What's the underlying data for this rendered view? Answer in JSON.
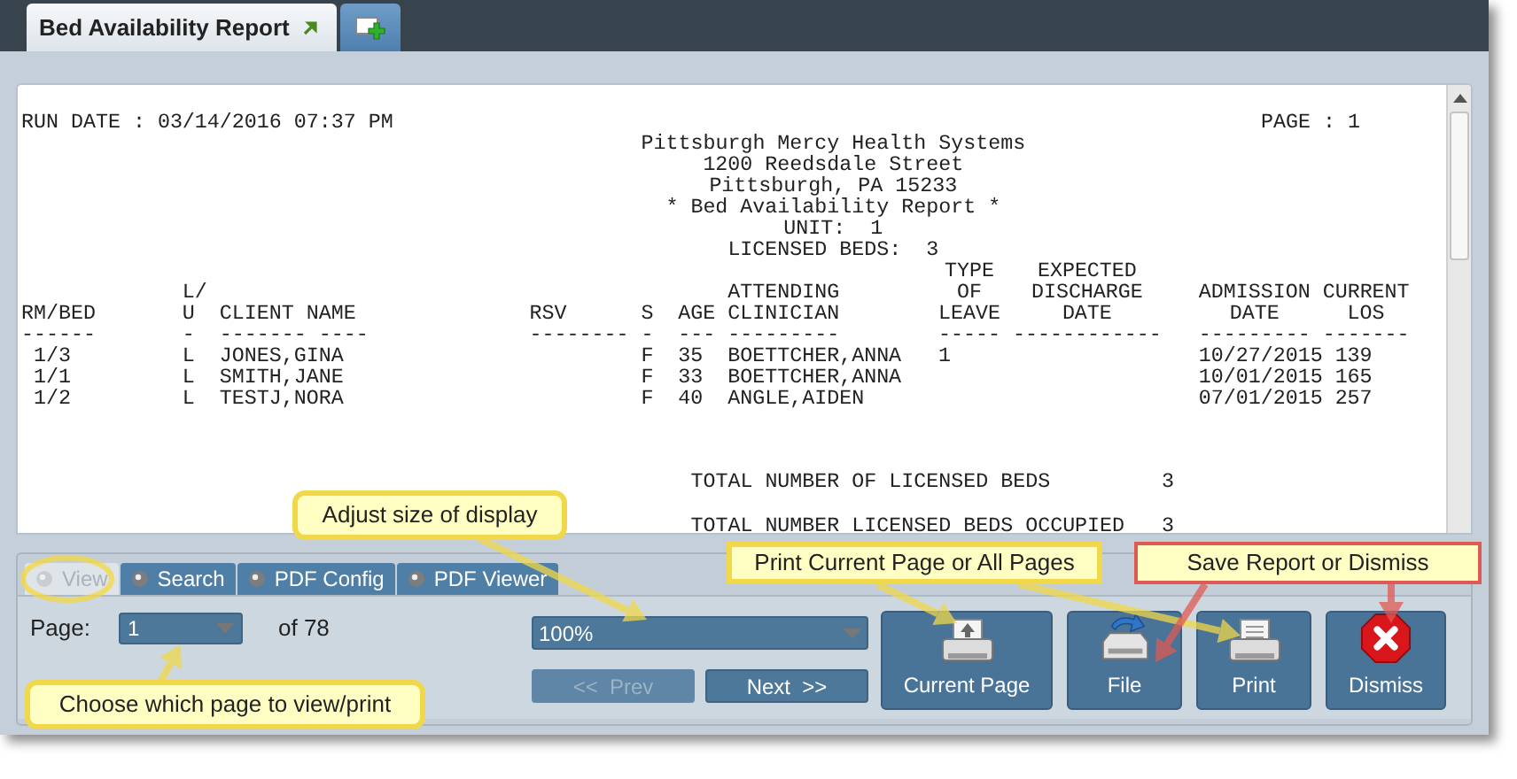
{
  "tabs": [
    {
      "label": "Bed Availability Report",
      "selected": true
    }
  ],
  "report": {
    "run_date": "RUN DATE : 03/14/2016 07:37 PM",
    "page": "PAGE : 1",
    "heading": [
      "Pittsburgh Mercy Health Systems",
      "1200 Reedsdale Street",
      "Pittsburgh, PA 15233",
      "* Bed Availability Report *",
      "UNIT:  1",
      "LICENSED BEDS:  3"
    ],
    "columns": [
      {
        "header": [
          "RM/BED"
        ],
        "underline": "------"
      },
      {
        "header": [
          "L/",
          "U"
        ],
        "underline": "-"
      },
      {
        "header": [
          "CLIENT NAME"
        ],
        "underline": "------- ----"
      },
      {
        "header": [
          "RSV"
        ],
        "underline": "--------"
      },
      {
        "header": [
          "S"
        ],
        "underline": "-"
      },
      {
        "header": [
          "AGE"
        ],
        "underline": "---"
      },
      {
        "header": [
          "ATTENDING",
          "CLINICIAN"
        ],
        "underline": "---------"
      },
      {
        "header": [
          "TYPE",
          "OF",
          "LEAVE"
        ],
        "underline": "-----"
      },
      {
        "header": [
          "EXPECTED",
          "DISCHARGE",
          "DATE"
        ],
        "underline": "------------"
      },
      {
        "header": [
          "ADMISSION",
          "DATE"
        ],
        "underline": "---------"
      },
      {
        "header": [
          "CURRENT",
          "LOS"
        ],
        "underline": "-------"
      }
    ],
    "rows": [
      [
        "1/3",
        "L",
        "JONES,GINA",
        "",
        "F",
        "35",
        "BOETTCHER,ANNA",
        "1",
        "",
        "10/27/2015",
        "139"
      ],
      [
        "1/1",
        "L",
        "SMITH,JANE",
        "",
        "F",
        "33",
        "BOETTCHER,ANNA",
        "",
        "",
        "10/01/2015",
        "165"
      ],
      [
        "1/2",
        "L",
        "TESTJ,NORA",
        "",
        "F",
        "40",
        "ANGLE,AIDEN",
        "",
        "",
        "07/01/2015",
        "257"
      ]
    ],
    "totals": [
      {
        "label": "TOTAL NUMBER OF LICENSED BEDS",
        "value": "3"
      },
      {
        "label": "TOTAL NUMBER LICENSED BEDS OCCUPIED",
        "value": "3"
      }
    ]
  },
  "panel": {
    "tabs": [
      {
        "label": "View",
        "selected": true
      },
      {
        "label": "Search",
        "selected": false
      },
      {
        "label": "PDF Config",
        "selected": false
      },
      {
        "label": "PDF Viewer",
        "selected": false
      }
    ],
    "page_label": "Page:",
    "page_select": "1",
    "page_count": "of 78",
    "zoom_select": "100%",
    "nav": [
      {
        "label": "<<  Prev",
        "disabled": true
      },
      {
        "label": "Next  >>",
        "disabled": false
      }
    ],
    "actions": [
      {
        "label": "Current Page",
        "kind": "print-page"
      },
      {
        "label": "File",
        "kind": "save"
      },
      {
        "label": "Print",
        "kind": "print"
      },
      {
        "label": "Dismiss",
        "kind": "dismiss"
      }
    ]
  },
  "callouts": [
    {
      "text": "Adjust size of display",
      "color": "#f0d84a"
    },
    {
      "text": "Choose which page to view/print",
      "color": "#f0d84a"
    },
    {
      "text": "Print Current Page or All Pages",
      "color": "#f0d84a"
    },
    {
      "text": "Save Report or Dismiss",
      "color": "#e05a55"
    }
  ]
}
